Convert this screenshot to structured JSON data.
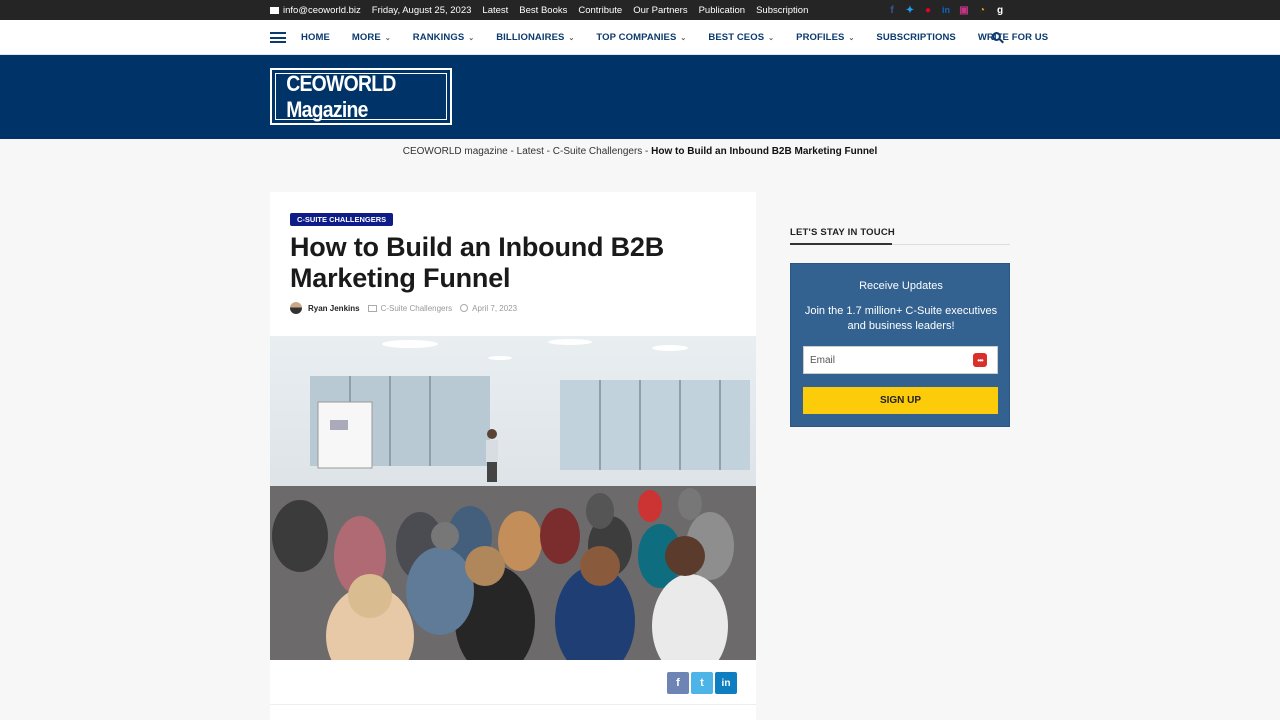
{
  "topbar": {
    "email": "info@ceoworld.biz",
    "date": "Friday, August 25, 2023",
    "links": [
      "Latest",
      "Best Books",
      "Contribute",
      "Our Partners",
      "Publication",
      "Subscription"
    ],
    "social_icons": [
      "facebook-icon",
      "twitter-icon",
      "pinterest-icon",
      "linkedin-icon",
      "instagram-icon",
      "rss-icon",
      "google-icon"
    ]
  },
  "nav": {
    "items": [
      {
        "label": "HOME",
        "dropdown": false
      },
      {
        "label": "MORE",
        "dropdown": true
      },
      {
        "label": "RANKINGS",
        "dropdown": true
      },
      {
        "label": "BILLIONAIRES",
        "dropdown": true
      },
      {
        "label": "TOP COMPANIES",
        "dropdown": true
      },
      {
        "label": "BEST CEOS",
        "dropdown": true
      },
      {
        "label": "PROFILES",
        "dropdown": true
      },
      {
        "label": "SUBSCRIPTIONS",
        "dropdown": false
      },
      {
        "label": "WRITE FOR US",
        "dropdown": false
      }
    ]
  },
  "brand": {
    "logo_text": "CEOWORLD Magazine",
    "color": "#003468"
  },
  "breadcrumb": {
    "items": [
      "CEOWORLD magazine",
      "Latest",
      "C-Suite Challengers"
    ],
    "current": "How to Build an Inbound B2B Marketing Funnel",
    "separator": " - "
  },
  "article": {
    "category": "C-SUITE CHALLENGERS",
    "title": "How to Build an Inbound B2B Marketing Funnel",
    "author": "Ryan Jenkins",
    "category_link": "C-Suite Challengers",
    "date": "April 7, 2023",
    "share": {
      "facebook": "f",
      "twitter": "t",
      "linkedin": "in"
    }
  },
  "sidebar": {
    "title": "LET'S STAY IN TOUCH",
    "box_title": "Receive Updates",
    "box_text": "Join the 1.7 million+ C-Suite executives and business leaders!",
    "email_placeholder": "Email",
    "button_label": "SIGN UP",
    "accent": "#fccb0a"
  }
}
